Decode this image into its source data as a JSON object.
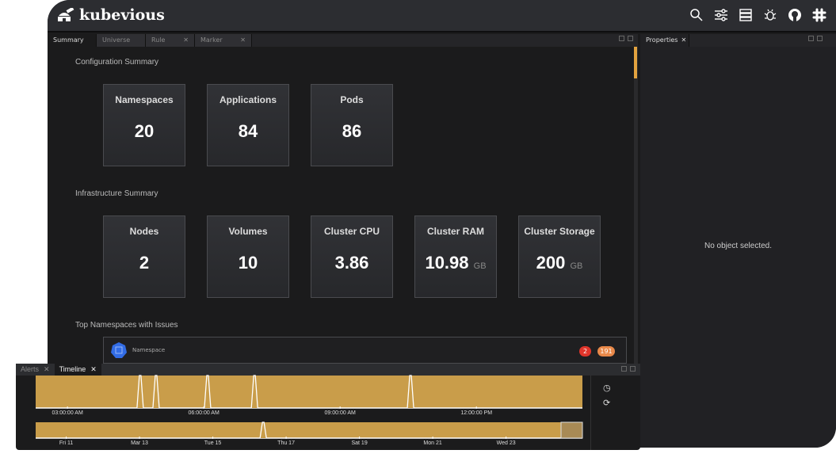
{
  "app": {
    "title": "kubevious",
    "accent": "#e3a33f"
  },
  "header": {
    "icons": [
      "search-icon",
      "sliders-icon",
      "server-icon",
      "bug-icon",
      "github-icon",
      "slack-icon"
    ]
  },
  "tabs": [
    {
      "label": "Summary",
      "closable": false,
      "active": true
    },
    {
      "label": "Universe",
      "closable": false
    },
    {
      "label": "Rule Editor",
      "closable": true
    },
    {
      "label": "Marker Editor",
      "closable": true
    }
  ],
  "summary": {
    "config_title": "Configuration Summary",
    "config_cards": [
      {
        "label": "Namespaces",
        "value": "20"
      },
      {
        "label": "Applications",
        "value": "84"
      },
      {
        "label": "Pods",
        "value": "86"
      }
    ],
    "infra_title": "Infrastructure Summary",
    "infra_cards": [
      {
        "label": "Nodes",
        "value": "2",
        "unit": ""
      },
      {
        "label": "Volumes",
        "value": "10",
        "unit": ""
      },
      {
        "label": "Cluster CPU",
        "value": "3.86",
        "unit": ""
      },
      {
        "label": "Cluster RAM",
        "value": "10.98",
        "unit": "GB"
      },
      {
        "label": "Cluster Storage",
        "value": "200",
        "unit": "GB"
      }
    ],
    "issues_title": "Top Namespaces with Issues",
    "issues": [
      {
        "name": "Namespace",
        "errors": "2",
        "warnings": "191",
        "error_color": "#e0352b",
        "warning_color": "#e9894a"
      }
    ]
  },
  "properties": {
    "tab": "Properties",
    "empty_text": "No object selected."
  },
  "timeline": {
    "tabs": [
      {
        "label": "Alerts"
      },
      {
        "label": "Timeline",
        "active": true
      }
    ],
    "detail": {
      "range": [
        "02:18",
        "14:20"
      ],
      "ticks": [
        "03:00:00 AM",
        "06:00:00 AM",
        "09:00:00 AM",
        "12:00:00 PM"
      ],
      "tick_hours": [
        3,
        6,
        9,
        12
      ],
      "spikes": [
        "04:36",
        "04:57",
        "06:05",
        "07:07",
        "10:33"
      ]
    },
    "overview": {
      "range": [
        "2022-03-10T04:00",
        "2022-03-25T02:00"
      ],
      "ticks": [
        "Fri 11",
        "Mar 13",
        "Tue 15",
        "Thu 17",
        "Sat 19",
        "Mon 21",
        "Wed 23"
      ],
      "tick_dates": [
        "2022-03-11",
        "2022-03-13",
        "2022-03-15",
        "2022-03-17",
        "2022-03-19",
        "2022-03-21",
        "2022-03-23"
      ],
      "spikes": [
        "2022-03-16T09:00"
      ],
      "selection": [
        "2022-03-24T12:00",
        "2022-03-25T02:00"
      ]
    },
    "fill_color": "#c99d4a",
    "buttons": [
      "history-icon",
      "refresh-icon"
    ]
  }
}
